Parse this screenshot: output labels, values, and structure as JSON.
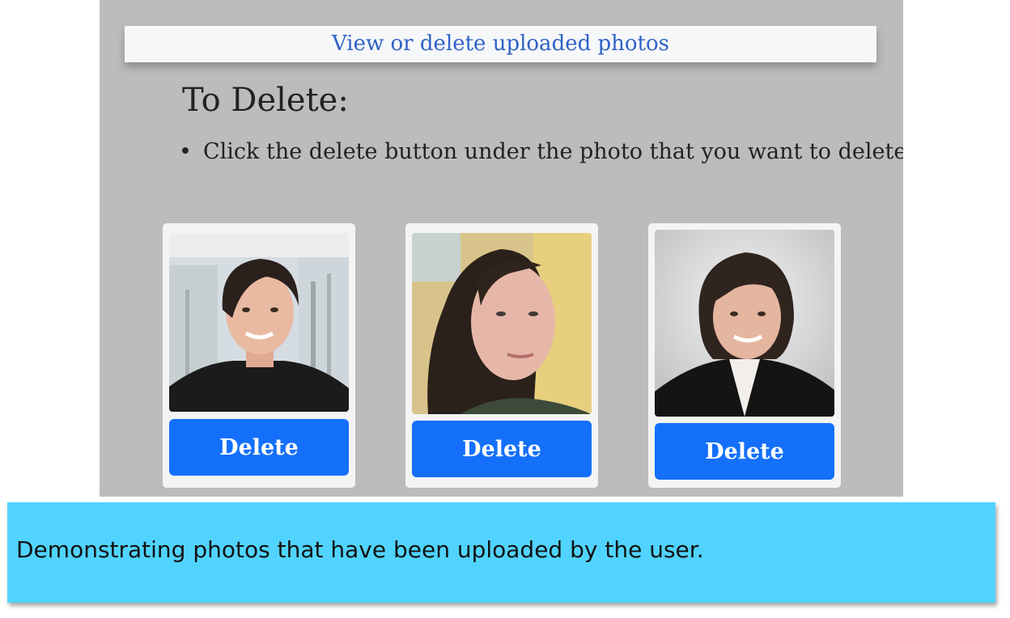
{
  "header": {
    "link_text": "View or delete uploaded photos"
  },
  "instructions": {
    "heading": "To Delete:",
    "items": [
      "Click the delete button under the photo that you want to delete"
    ]
  },
  "photos": [
    {
      "delete_label": "Delete"
    },
    {
      "delete_label": "Delete"
    },
    {
      "delete_label": "Delete"
    }
  ],
  "caption": {
    "text": "Demonstrating photos that have been uploaded by the user."
  },
  "colors": {
    "panel_bg": "#bcbcbc",
    "link": "#2f62c6",
    "delete_button": "#1470fb",
    "caption_bg": "#50d4ff"
  }
}
